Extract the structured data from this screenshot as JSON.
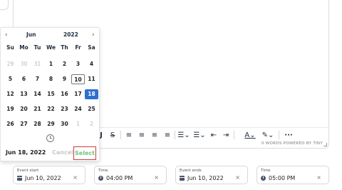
{
  "calendar": {
    "month": "Jun",
    "year": "2022",
    "prev": "‹",
    "next": "›",
    "weekdays": [
      "Su",
      "Mo",
      "Tu",
      "We",
      "Th",
      "Fr",
      "Sa"
    ],
    "weeks": [
      [
        {
          "d": "29",
          "m": true
        },
        {
          "d": "30",
          "m": true
        },
        {
          "d": "31",
          "m": true
        },
        {
          "d": "1"
        },
        {
          "d": "2"
        },
        {
          "d": "3"
        },
        {
          "d": "4"
        }
      ],
      [
        {
          "d": "5"
        },
        {
          "d": "6"
        },
        {
          "d": "7"
        },
        {
          "d": "8"
        },
        {
          "d": "9"
        },
        {
          "d": "10",
          "today": true
        },
        {
          "d": "11"
        }
      ],
      [
        {
          "d": "12"
        },
        {
          "d": "13"
        },
        {
          "d": "14"
        },
        {
          "d": "15"
        },
        {
          "d": "16"
        },
        {
          "d": "17"
        },
        {
          "d": "18",
          "sel": true
        }
      ],
      [
        {
          "d": "19"
        },
        {
          "d": "20"
        },
        {
          "d": "21"
        },
        {
          "d": "22"
        },
        {
          "d": "23"
        },
        {
          "d": "24"
        },
        {
          "d": "25"
        }
      ],
      [
        {
          "d": "26"
        },
        {
          "d": "27"
        },
        {
          "d": "28"
        },
        {
          "d": "29"
        },
        {
          "d": "30"
        },
        {
          "d": "1",
          "m": true
        },
        {
          "d": "2",
          "m": true
        }
      ]
    ],
    "picked_date": "Jun 18, 2022",
    "cancel_label": "Cancel",
    "select_label": "Select",
    "selected_color": "#2f6fd0",
    "select_color": "#6bc47a",
    "highlight_border": "#d33a3a"
  },
  "editor": {
    "status": "0 WORDS POWERED BY TINY",
    "toolbar_icons": [
      "text-color-a-icon",
      "strike-icon",
      "align-left-icon",
      "align-center-icon",
      "align-right-icon",
      "align-justify-icon",
      "bullet-list-icon",
      "numbered-list-icon",
      "outdent-icon",
      "indent-icon",
      "font-color-icon",
      "highlight-icon",
      "more-icon"
    ]
  },
  "fields": {
    "event_start": {
      "label": "Event start",
      "value": "Jun 10, 2022",
      "icon": "calendar-icon"
    },
    "time_start": {
      "label": "Time",
      "value": "04:00 PM",
      "icon": "clock-icon"
    },
    "event_ends": {
      "label": "Event ends",
      "value": "Jun 10, 2022",
      "icon": "calendar-icon"
    },
    "time_end": {
      "label": "Time",
      "value": "05:00 PM",
      "icon": "clock-icon"
    },
    "clear": "×"
  }
}
